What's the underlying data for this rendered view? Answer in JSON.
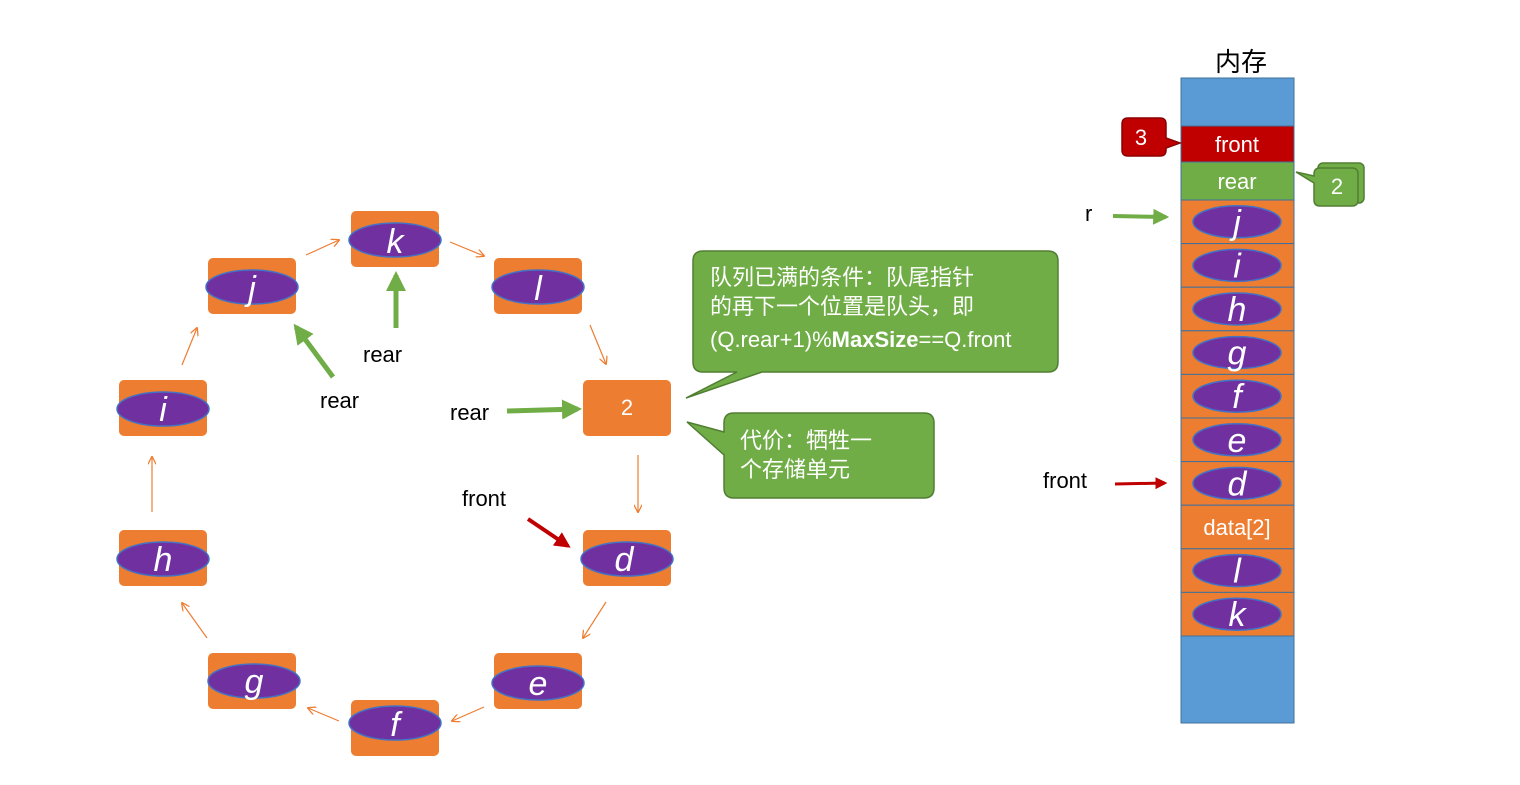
{
  "colors": {
    "orange": "#ED7D31",
    "purple": "#7030A0",
    "ellipse_stroke": "#4472C4",
    "green": "#70AD47",
    "green_dark": "#507E32",
    "red": "#C00000",
    "blue": "#5B9BD5",
    "arrow_orange": "#ED7D31"
  },
  "ring": {
    "nodes": [
      {
        "id": "k",
        "label": "k",
        "ellipse": true
      },
      {
        "id": "l",
        "label": "l",
        "ellipse": true
      },
      {
        "id": "empty",
        "label": "2",
        "ellipse": false
      },
      {
        "id": "d",
        "label": "d",
        "ellipse": true
      },
      {
        "id": "e",
        "label": "e",
        "ellipse": true
      },
      {
        "id": "f",
        "label": "f",
        "ellipse": true
      },
      {
        "id": "g",
        "label": "g",
        "ellipse": true
      },
      {
        "id": "h",
        "label": "h",
        "ellipse": true
      },
      {
        "id": "i",
        "label": "i",
        "ellipse": true
      },
      {
        "id": "j",
        "label": "j",
        "ellipse": true
      }
    ],
    "pointers": [
      {
        "label": "rear",
        "color": "green"
      },
      {
        "label": "rear",
        "color": "green"
      },
      {
        "label": "rear",
        "color": "green"
      },
      {
        "label": "front",
        "color": "red"
      }
    ]
  },
  "callouts": {
    "full_condition": {
      "line1": "队列已满的条件：队尾指针",
      "line2": "的再下一个位置是队头，即",
      "expr_pre": "(Q.rear+1)%",
      "expr_bold": "MaxSize",
      "expr_post": "==Q.front"
    },
    "cost": {
      "line1": "代价：牺牲一",
      "line2": "个存储单元"
    }
  },
  "memory": {
    "title": "内存",
    "front_label": "front",
    "rear_label": "rear",
    "front_badge": "3",
    "rear_badge": "2",
    "cells": [
      {
        "label": "j",
        "ellipse": true
      },
      {
        "label": "i",
        "ellipse": true
      },
      {
        "label": "h",
        "ellipse": true
      },
      {
        "label": "g",
        "ellipse": true
      },
      {
        "label": "f",
        "ellipse": true
      },
      {
        "label": "e",
        "ellipse": true
      },
      {
        "label": "d",
        "ellipse": true
      },
      {
        "label": "data[2]",
        "ellipse": false
      },
      {
        "label": "l",
        "ellipse": true
      },
      {
        "label": "k",
        "ellipse": true
      }
    ],
    "pointers": {
      "r": "r",
      "front": "front"
    }
  }
}
